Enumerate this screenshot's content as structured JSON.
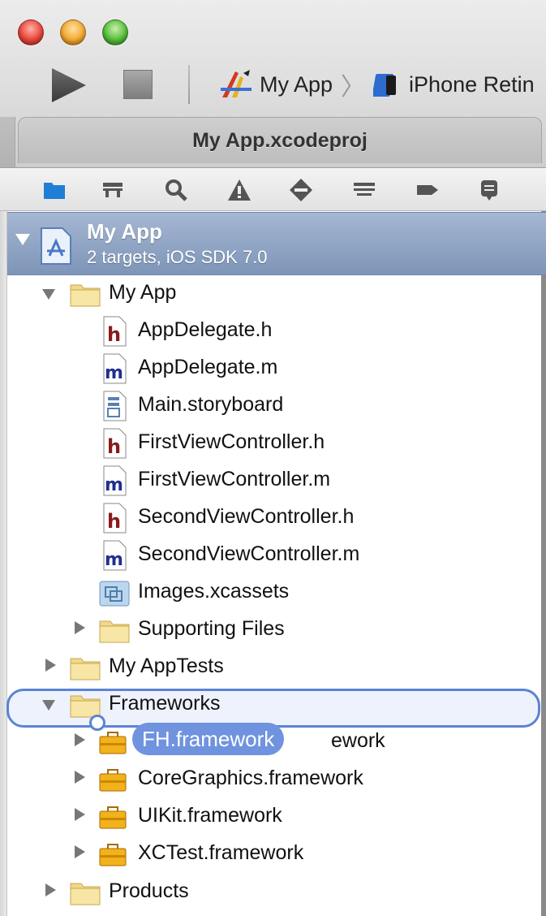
{
  "toolbar": {
    "scheme_app": "My App",
    "scheme_device": "iPhone Retin"
  },
  "tab": {
    "title": "My App.xcodeproj"
  },
  "navigator_icons": [
    "folder-icon",
    "hierarchy-icon",
    "search-icon",
    "warning-icon",
    "breakpoint-test-icon",
    "debug-icon",
    "breakpoint-icon",
    "log-icon"
  ],
  "project": {
    "name": "My App",
    "subtitle": "2 targets, iOS SDK 7.0"
  },
  "tree": {
    "my_app_group": "My App",
    "files": [
      {
        "name": "AppDelegate.h",
        "kind": "h"
      },
      {
        "name": "AppDelegate.m",
        "kind": "m"
      },
      {
        "name": "Main.storyboard",
        "kind": "storyboard"
      },
      {
        "name": "FirstViewController.h",
        "kind": "h"
      },
      {
        "name": "FirstViewController.m",
        "kind": "m"
      },
      {
        "name": "SecondViewController.h",
        "kind": "h"
      },
      {
        "name": "SecondViewController.m",
        "kind": "m"
      },
      {
        "name": "Images.xcassets",
        "kind": "xcassets"
      }
    ],
    "supporting_files": "Supporting Files",
    "tests_group": "My AppTests",
    "frameworks_group": "Frameworks",
    "framework_hidden_tail": "ework",
    "frameworks": [
      "CoreGraphics.framework",
      "UIKit.framework",
      "XCTest.framework"
    ],
    "products": "Products"
  },
  "drag": {
    "label": "FH.framework"
  },
  "colors": {
    "selection": "#7e95b8",
    "drop_highlight": "#5c83d6",
    "header_h": "#8b1a1a",
    "header_m": "#1f2f8f"
  }
}
